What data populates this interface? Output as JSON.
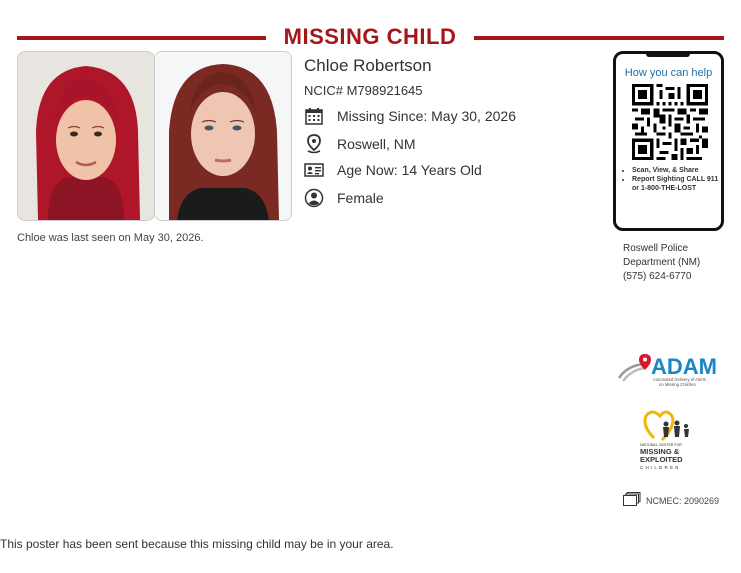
{
  "poster": {
    "title": "MISSING CHILD",
    "name": "Chloe Robertson",
    "ncic": "NCIC# M798921645",
    "missing_since": "Missing Since: May 30, 2026",
    "location": "Roswell, NM",
    "age_now": "Age Now: 14 Years Old",
    "sex": "Female",
    "circumstance": "Chloe was last seen on May 30, 2026.",
    "footer_note": "This poster has been sent because this missing child may be in your area."
  },
  "qr_panel": {
    "heading": "How you can help",
    "bullets": [
      "Scan, View, & Share",
      "Report Sighting CALL 911 or 1-800-THE-LOST"
    ]
  },
  "agency": {
    "line1": "Roswell Police",
    "line2": "Department (NM)",
    "phone": "(575) 624-6770"
  },
  "logos": {
    "adam_text": "ADAM",
    "adam_subtitle_1": "Automated Delivery of Alerts",
    "adam_subtitle_2": "on Missing Children",
    "ncmec_line1": "NATIONAL CENTER FOR",
    "ncmec_line2": "MISSING &",
    "ncmec_line3": "EXPLOITED",
    "ncmec_line4": "CHILDREN"
  },
  "ncmec_case": "NCMEC: 2090269",
  "colors": {
    "accent": "#a4161a",
    "link_blue": "#1d6fa5",
    "adam_blue": "#1a86c8",
    "ncmec_yellow": "#f2b705"
  },
  "icons": [
    "calendar-icon",
    "map-pin-icon",
    "id-card-icon",
    "person-icon",
    "folder-stack-icon"
  ]
}
